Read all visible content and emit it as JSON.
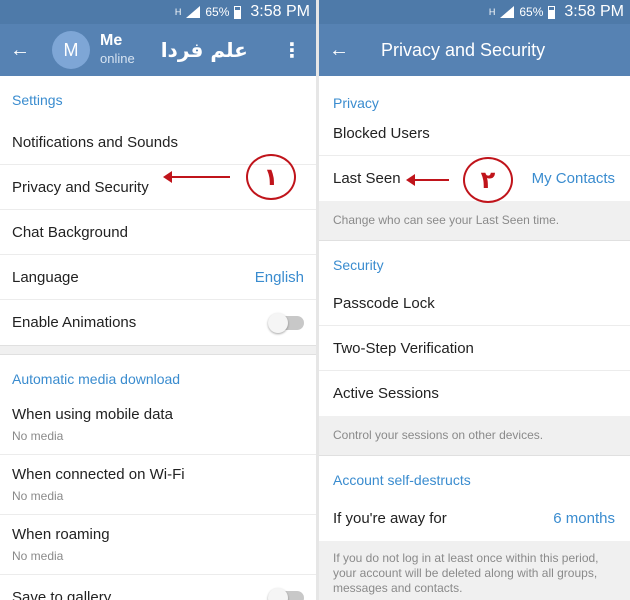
{
  "status_bar": {
    "network": "H",
    "battery": "65%",
    "time": "3:58 PM"
  },
  "settings_screen": {
    "back_icon": "arrow-left-icon",
    "avatar_letter": "M",
    "user_name": "Me",
    "user_status": "online",
    "brand": "علم فردا",
    "more_icon": "more-vert-icon",
    "sections": [
      {
        "header": "Settings"
      },
      {
        "header": "Automatic media download"
      }
    ],
    "settings_items": [
      {
        "label": "Notifications and Sounds"
      },
      {
        "label": "Privacy and Security"
      },
      {
        "label": "Chat Background"
      },
      {
        "label": "Language",
        "value": "English"
      },
      {
        "label": "Enable Animations",
        "toggle": "off"
      }
    ],
    "media_items": [
      {
        "label": "When using mobile data",
        "sub": "No media"
      },
      {
        "label": "When connected on Wi-Fi",
        "sub": "No media"
      },
      {
        "label": "When roaming",
        "sub": "No media"
      },
      {
        "label": "Save to gallery",
        "toggle": "off"
      }
    ],
    "annotation_number": "١"
  },
  "privacy_screen": {
    "back_icon": "arrow-left-icon",
    "title": "Privacy and Security",
    "privacy_header": "Privacy",
    "blocked_users": "Blocked Users",
    "last_seen": {
      "label": "Last Seen",
      "value": "My Contacts"
    },
    "last_seen_info": "Change who can see your Last Seen time.",
    "security_header": "Security",
    "security_items": [
      {
        "label": "Passcode Lock"
      },
      {
        "label": "Two-Step Verification"
      },
      {
        "label": "Active Sessions"
      }
    ],
    "sessions_info": "Control your sessions on other devices.",
    "destruct_header": "Account self-destructs",
    "away": {
      "label": "If you're away for",
      "value": "6 months"
    },
    "destruct_info": "If you do not log in at least once within this period, your account will be deleted along with all groups, messages and contacts.",
    "annotation_number": "٢"
  },
  "colors": {
    "header": "#5682b3",
    "statusbar": "#4e7aa9",
    "accent": "#3a8ccf",
    "annotation": "#c0141b"
  }
}
